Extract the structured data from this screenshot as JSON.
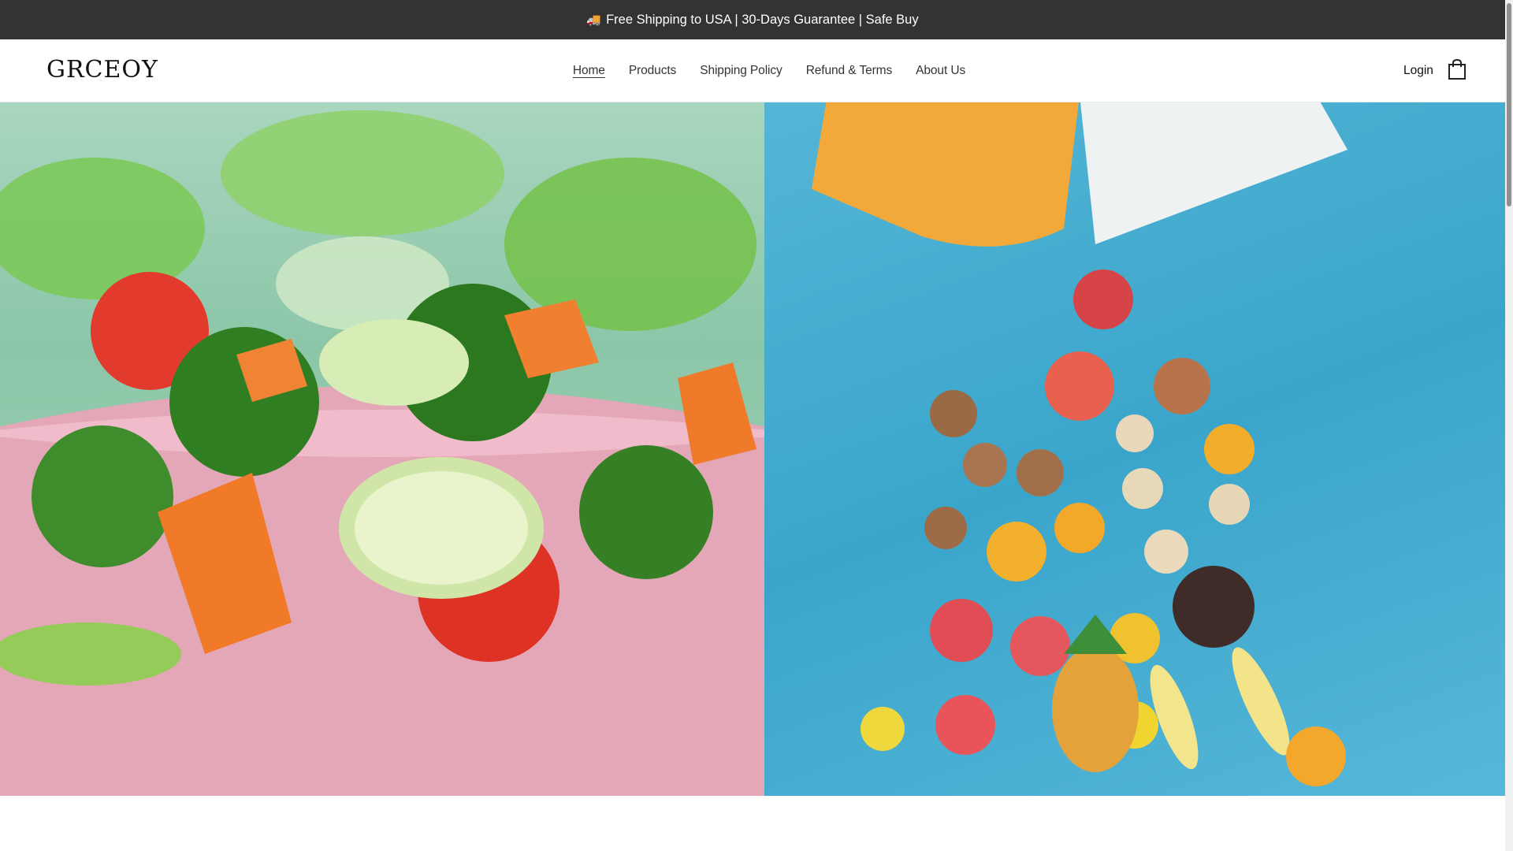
{
  "announcement": {
    "icon": "truck-icon",
    "text": "Free Shipping to USA | 30-Days Guarantee | Safe Buy"
  },
  "header": {
    "logo": "GRCEOY",
    "nav": [
      {
        "label": "Home",
        "active": true
      },
      {
        "label": "Products",
        "active": false
      },
      {
        "label": "Shipping Policy",
        "active": false
      },
      {
        "label": "Refund & Terms",
        "active": false
      },
      {
        "label": "About Us",
        "active": false
      }
    ],
    "login_label": "Login",
    "cart_icon": "shopping-bag-icon"
  },
  "hero": {
    "left_image": "salad bowl with broccoli, tomato, carrot, cucumber and lettuce",
    "right_image": "fruits spilling from a bag onto blue background",
    "slider": {
      "prev_icon": "chevron-left-icon",
      "next_icon": "chevron-right-icon",
      "total_slides": 1,
      "active_slide": 1
    }
  },
  "colors": {
    "announcement_bg": "#333333",
    "left_bg": "#9dcfb3",
    "right_bg": "#3aa5cb",
    "bowl": "#e2a7b4"
  }
}
